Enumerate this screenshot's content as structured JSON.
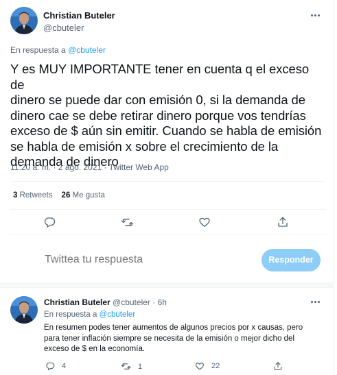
{
  "main_tweet": {
    "author_name": "Christian Buteler",
    "author_handle": "@cbuteler",
    "reply_prefix": "En respuesta a ",
    "reply_handle": "@cbuteler",
    "text": "Y es MUY IMPORTANTE tener en cuenta q el exceso de\ndinero se puede dar con emisión 0, si la demanda de\ndinero cae se debe retirar dinero porque vos tendrías\nexceso de $ aún sin emitir. Cuando se habla de emisión\nse habla de emisión x sobre el crecimiento de la\ndemanda de dinero",
    "timestamp": "11:20 a. m. · 2 ago. 2021 · Twitter Web App",
    "retweets_count": "3",
    "retweets_label": "Retweets",
    "likes_count": "26",
    "likes_label": "Me gusta"
  },
  "compose": {
    "placeholder": "Twittea tu respuesta",
    "button_label": "Responder"
  },
  "reply_tweet": {
    "author_name": "Christian Buteler",
    "author_handle": "@cbuteler",
    "separator": "·",
    "time": "6h",
    "reply_prefix": "En respuesta a ",
    "reply_handle": "@cbuteler",
    "text": "En resumen podes tener aumentos de algunos precios por x causas, pero\npara tener inflación siempre se necesita de la emisión o mejor dicho del\nexceso de $ en la economía.",
    "reply_count": "4",
    "retweet_count": "1",
    "like_count": "22"
  },
  "colors": {
    "accent": "#1d9bf0",
    "button_disabled": "#8ecdf8",
    "secondary_text": "#536471"
  },
  "icons": [
    "more-icon",
    "reply-icon",
    "retweet-icon",
    "like-icon",
    "share-icon"
  ]
}
